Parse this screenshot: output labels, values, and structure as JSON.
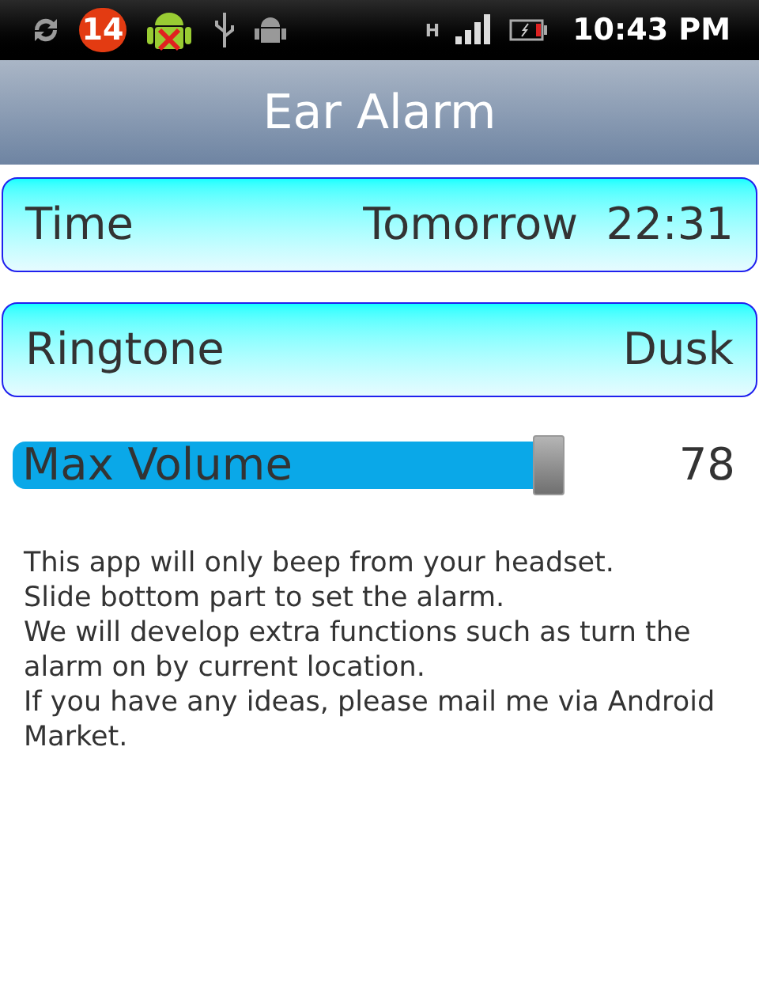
{
  "status_bar": {
    "notification_count": "14",
    "time": "10:43 PM",
    "network": "H"
  },
  "title": "Ear Alarm",
  "settings": [
    {
      "label": "Time",
      "value": "Tomorrow  22:31"
    },
    {
      "label": "Ringtone",
      "value": "Dusk"
    }
  ],
  "volume": {
    "label": "Max Volume",
    "level": 0.78,
    "reading": "78"
  },
  "description": [
    "This app will only beep from your headset.",
    "Slide bottom part to set the alarm.",
    "We will develop extra functions such as turn the alarm on by current location.",
    "If you have any ideas, please mail me via Android Market."
  ]
}
